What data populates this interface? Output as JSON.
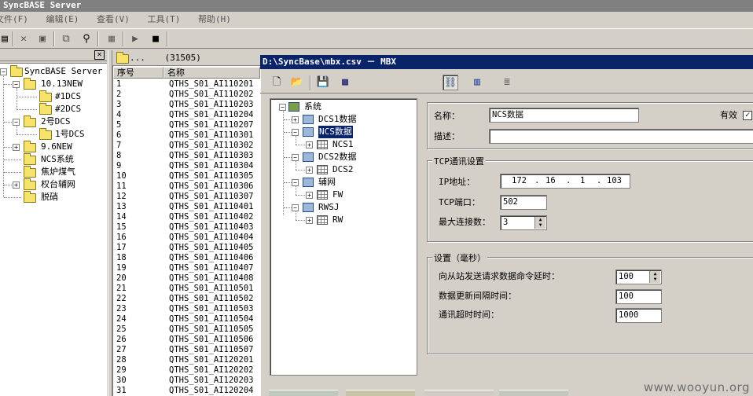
{
  "app": {
    "title": "SyncBASE Server"
  },
  "menu": [
    "文件(F)",
    "编辑(E)",
    "查看(V)",
    "工具(T)",
    "帮助(H)"
  ],
  "left_tree": {
    "root": "SyncBASE Server",
    "nodes": [
      {
        "label": "10.13NEW"
      },
      {
        "label": "#1DCS"
      },
      {
        "label": "#2DCS"
      },
      {
        "label": "2号DCS"
      },
      {
        "label": "1号DCS"
      },
      {
        "label": "9.6NEW"
      },
      {
        "label": "NCS系统"
      },
      {
        "label": "焦炉煤气"
      },
      {
        "label": "权台辅网"
      },
      {
        "label": "脱硝"
      }
    ]
  },
  "list": {
    "path": "...",
    "count": "(31505)",
    "col_index": "序号",
    "col_name": "名称",
    "rows": [
      [
        "1",
        "QTHS_S01_AI110201"
      ],
      [
        "2",
        "QTHS_S01_AI110202"
      ],
      [
        "3",
        "QTHS_S01_AI110203"
      ],
      [
        "4",
        "QTHS_S01_AI110204"
      ],
      [
        "5",
        "QTHS_S01_AI110207"
      ],
      [
        "6",
        "QTHS_S01_AI110301"
      ],
      [
        "7",
        "QTHS_S01_AI110302"
      ],
      [
        "8",
        "QTHS_S01_AI110303"
      ],
      [
        "9",
        "QTHS_S01_AI110304"
      ],
      [
        "10",
        "QTHS_S01_AI110305"
      ],
      [
        "11",
        "QTHS_S01_AI110306"
      ],
      [
        "12",
        "QTHS_S01_AI110307"
      ],
      [
        "13",
        "QTHS_S01_AI110401"
      ],
      [
        "14",
        "QTHS_S01_AI110402"
      ],
      [
        "15",
        "QTHS_S01_AI110403"
      ],
      [
        "16",
        "QTHS_S01_AI110404"
      ],
      [
        "17",
        "QTHS_S01_AI110405"
      ],
      [
        "18",
        "QTHS_S01_AI110406"
      ],
      [
        "19",
        "QTHS_S01_AI110407"
      ],
      [
        "20",
        "QTHS_S01_AI110408"
      ],
      [
        "21",
        "QTHS_S01_AI110501"
      ],
      [
        "22",
        "QTHS_S01_AI110502"
      ],
      [
        "23",
        "QTHS_S01_AI110503"
      ],
      [
        "24",
        "QTHS_S01_AI110504"
      ],
      [
        "25",
        "QTHS_S01_AI110505"
      ],
      [
        "26",
        "QTHS_S01_AI110506"
      ],
      [
        "27",
        "QTHS_S01_AI110507"
      ],
      [
        "28",
        "QTHS_S01_AI120201"
      ],
      [
        "29",
        "QTHS_S01_AI120202"
      ],
      [
        "30",
        "QTHS_S01_AI120203"
      ],
      [
        "31",
        "QTHS_S01_AI120204"
      ]
    ]
  },
  "dialog": {
    "title": "D:\\SyncBase\\mbx.csv － MBX",
    "tree": {
      "root": "系统",
      "items": [
        {
          "label": "DCS1数据"
        },
        {
          "label": "NCS数据",
          "selected": true
        },
        {
          "label": "NCS1"
        },
        {
          "label": "DCS2数据"
        },
        {
          "label": "DCS2"
        },
        {
          "label": "辅网"
        },
        {
          "label": "FW"
        },
        {
          "label": "RWSJ"
        },
        {
          "label": "RW"
        }
      ]
    },
    "form": {
      "name_label": "名称：",
      "name_value": "NCS数据",
      "valid_label": "有效",
      "valid_checked": "✓",
      "desc_label": "描述：",
      "desc_value": "",
      "tcp_group": "TCP通讯设置",
      "ip_label": "IP地址：",
      "ip": [
        "172",
        "16",
        "1",
        "103"
      ],
      "port_label": "TCP端口：",
      "port_value": "502",
      "maxconn_label": "最大连接数：",
      "maxconn_value": "3",
      "settings_group": "设置（毫秒）",
      "delay_label": "向从站发送请求数据命令延时：",
      "delay_value": "100",
      "update_label": "数据更新间隔时间：",
      "update_value": "100",
      "timeout_label": "通讯超时时间：",
      "timeout_value": "1000"
    }
  },
  "watermark": "www.wooyun.org"
}
